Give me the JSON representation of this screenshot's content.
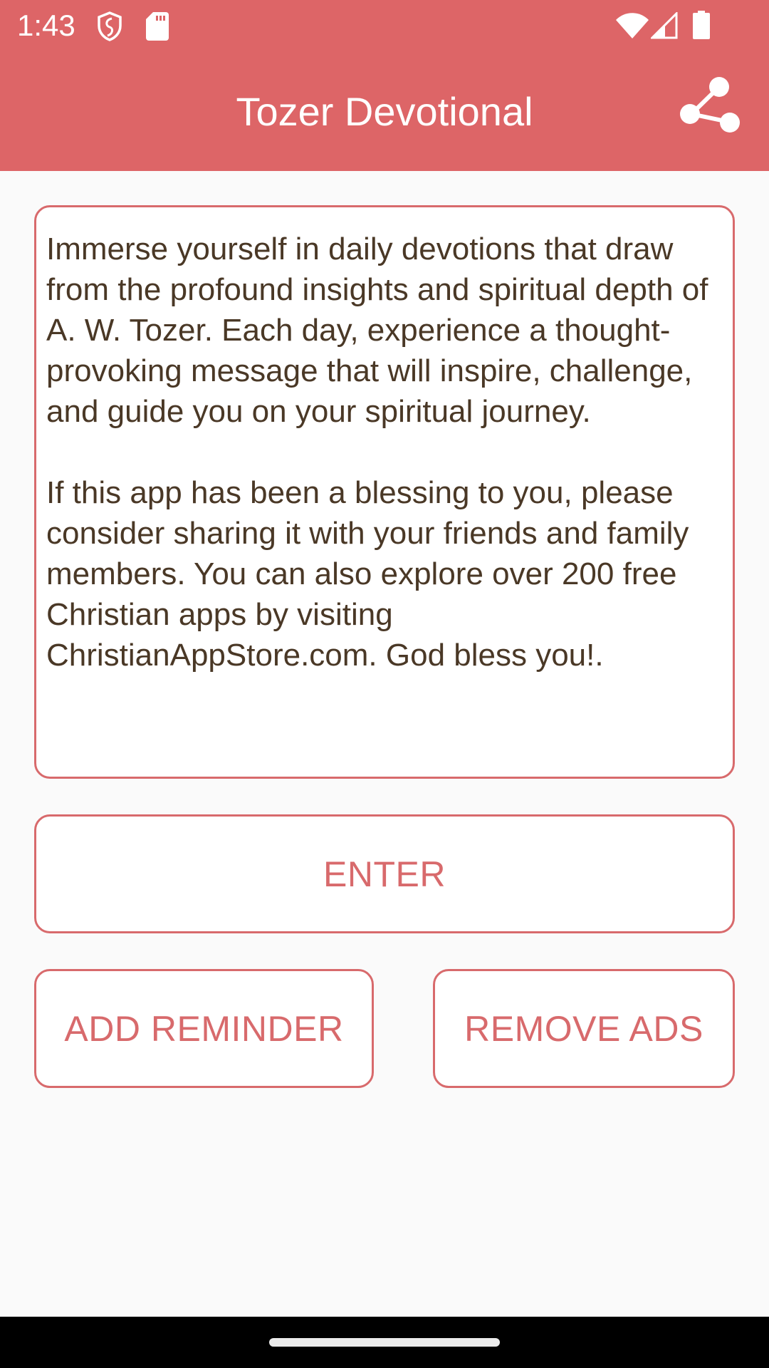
{
  "status_bar": {
    "time": "1:43",
    "left_icons": [
      "shield-vpn-icon",
      "sd-card-icon"
    ],
    "right_icons": [
      "wifi-icon",
      "signal-icon",
      "battery-icon"
    ]
  },
  "app_bar": {
    "title": "Tozer Devotional",
    "action_icon": "share-icon"
  },
  "description": {
    "paragraphs": [
      "Immerse yourself in daily devotions that draw from the profound insights and spiritual depth of A. W. Tozer. Each day, experience a thought-provoking message that will inspire, challenge, and guide you on your spiritual journey.",
      "If this app has been a blessing to you, please consider sharing it with your friends and family members. You can also explore over 200 free Christian apps by visiting ChristianAppStore.com. God bless you!."
    ]
  },
  "buttons": {
    "enter": "ENTER",
    "add_reminder": "ADD REMINDER",
    "remove_ads": "REMOVE ADS"
  },
  "colors": {
    "primary": "#dd6567",
    "button_border": "#d86a6c",
    "body_text": "#4a3826",
    "background": "#fafafa"
  }
}
